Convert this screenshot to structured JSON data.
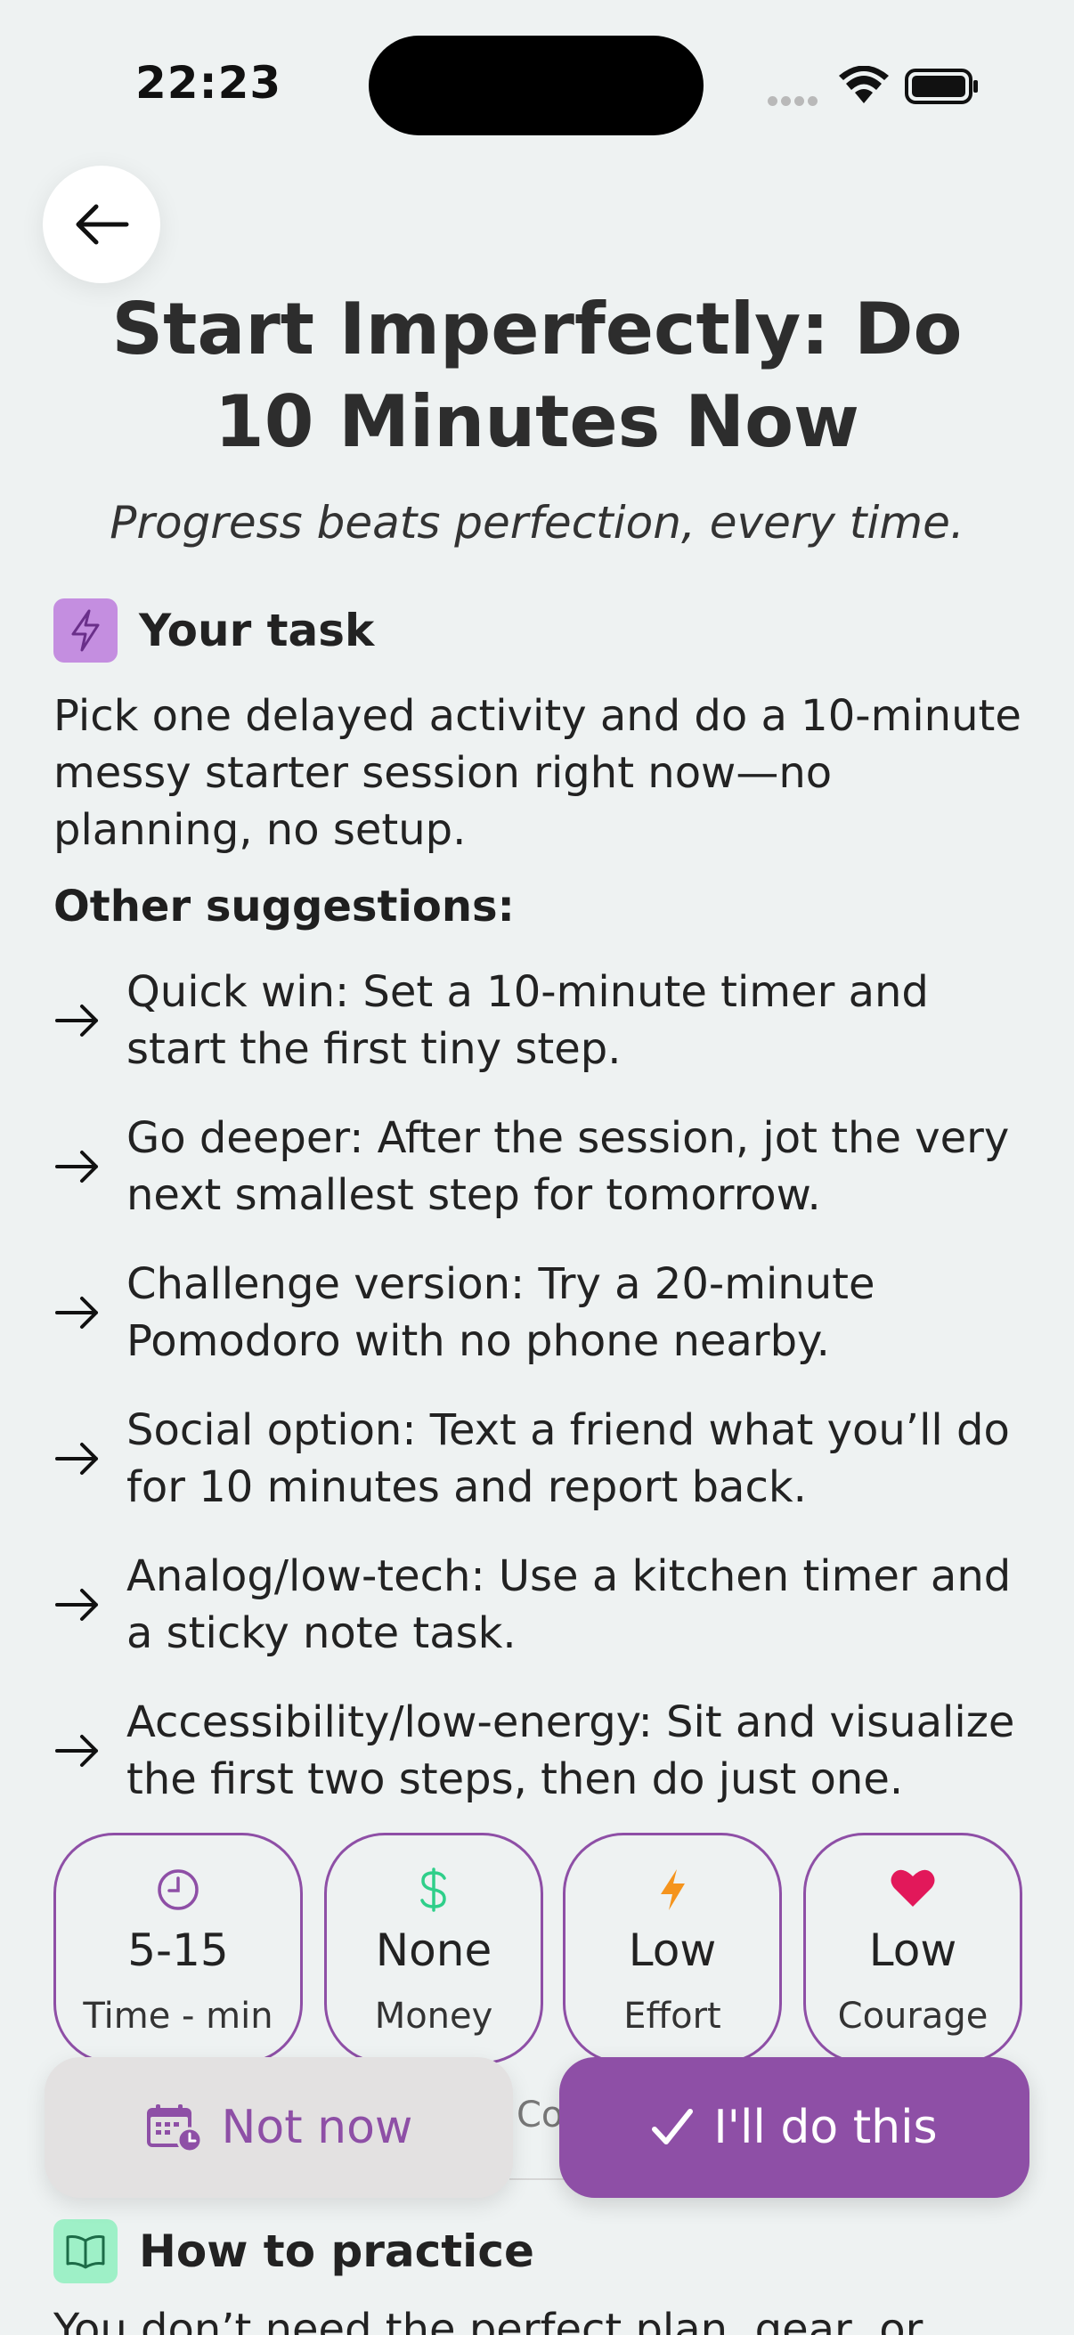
{
  "status_bar": {
    "time": "22:23"
  },
  "header": {
    "title": "Start Imperfectly: Do 10 Minutes Now",
    "subtitle": "Progress beats perfection, every time."
  },
  "task": {
    "heading": "Your task",
    "text": "Pick one delayed activity and do a 10-minute messy starter session right now—no planning, no setup."
  },
  "suggestions": {
    "heading": "Other suggestions:",
    "items": [
      "Quick win: Set a 10-minute timer and start the first tiny step.",
      "Go deeper: After the session, jot the very next smallest step for tomorrow.",
      "Challenge version: Try a 20-minute Pomodoro with no phone nearby.",
      "Social option: Text a friend what you’ll do for 10 minutes and report back.",
      "Analog/low-tech: Use a kitchen timer and a sticky note task.",
      "Accessibility/low-energy: Sit and visualize the first two steps, then do just one."
    ]
  },
  "stats": [
    {
      "icon": "clock-icon",
      "value": "5-15",
      "label": "Time - min",
      "color": "#8e4fa6"
    },
    {
      "icon": "dollar-icon",
      "value": "None",
      "label": "Money",
      "color": "#2fcf8a"
    },
    {
      "icon": "lightning-icon",
      "value": "Low",
      "label": "Effort",
      "color": "#f5941d"
    },
    {
      "icon": "heart-icon",
      "value": "Low",
      "label": "Courage",
      "color": "#e2185a"
    }
  ],
  "partially_hidden": {
    "behind_buttons": "Co"
  },
  "actions": {
    "not_now": "Not now",
    "do_this": "I'll do this"
  },
  "practice": {
    "heading": "How to practice",
    "text_cut": "You don’t need the perfect plan, gear, or"
  },
  "colors": {
    "accent": "#8e4fa6",
    "background": "#eef2f2",
    "task_icon_bg": "#c48ee0",
    "practice_icon_bg": "#9ef0c7"
  }
}
